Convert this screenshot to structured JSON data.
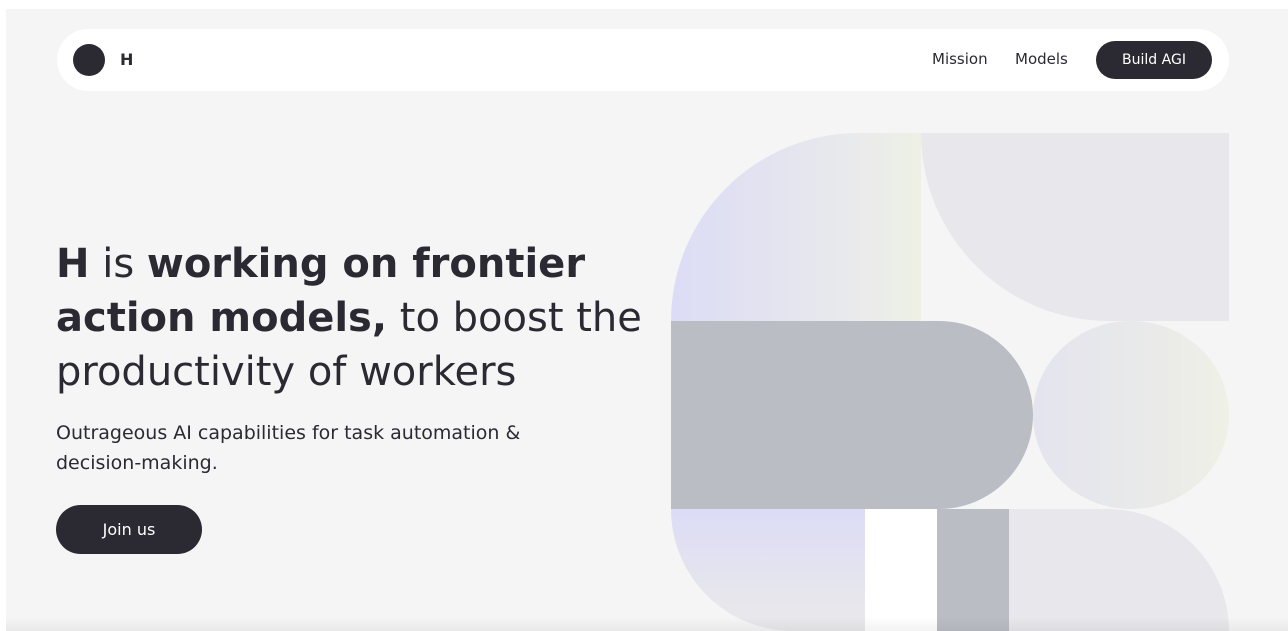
{
  "nav": {
    "logo_letter": "H",
    "links": [
      "Mission",
      "Models"
    ],
    "cta_label": "Build AGI"
  },
  "hero": {
    "title_parts": [
      "H",
      " is ",
      "working on frontier action models,",
      " to boost the productivity of workers"
    ],
    "subtitle": "Outrageous AI capabilities for task automation & decision-making.",
    "button_label": "Join us"
  },
  "colors": {
    "ink": "#2b2a33",
    "background": "#f5f5f5",
    "shape_gray": "#bbbdc5",
    "shape_light": "#e8e8ec",
    "shape_lavender": "#dcdcf6"
  }
}
